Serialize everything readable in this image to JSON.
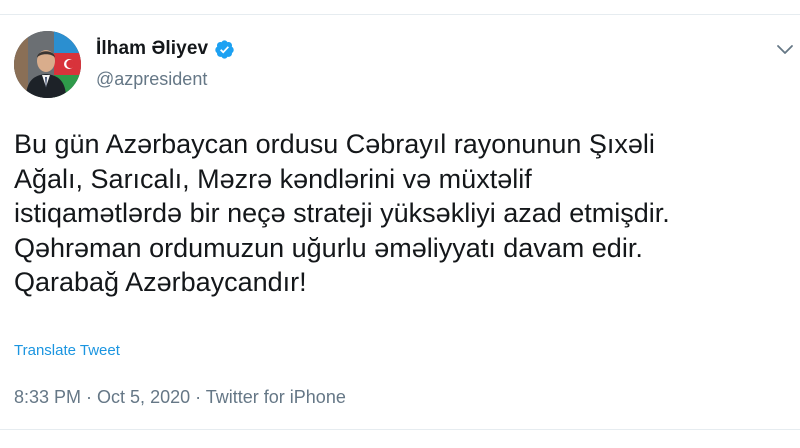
{
  "tweet": {
    "author": {
      "display_name": "İlham Əliyev",
      "handle": "@azpresident",
      "verified": true,
      "avatar_icon": "profile-photo"
    },
    "text": "Bu gün Azərbaycan ordusu Cəbrayıl rayonunun Şıxəli\nAğalı, Sarıcalı, Məzrə kəndlərini və müxtəlif\nistiqamətlərdə bir neçə strateji yüksəkliyi azad etmişdir.\nQəhrəman ordumuzun uğurlu əməliyyatı davam edir.\nQarabağ Azərbaycandır!",
    "translate_label": "Translate Tweet",
    "time": "8:33 PM",
    "separator": " · ",
    "date": "Oct 5, 2020",
    "source": "Twitter for iPhone",
    "menu_icon": "chevron-down-icon"
  },
  "colors": {
    "text_primary": "#14171a",
    "text_secondary": "#657786",
    "link": "#1b95e0",
    "verified_badge": "#1da1f2",
    "divider": "#e6ecf0"
  }
}
